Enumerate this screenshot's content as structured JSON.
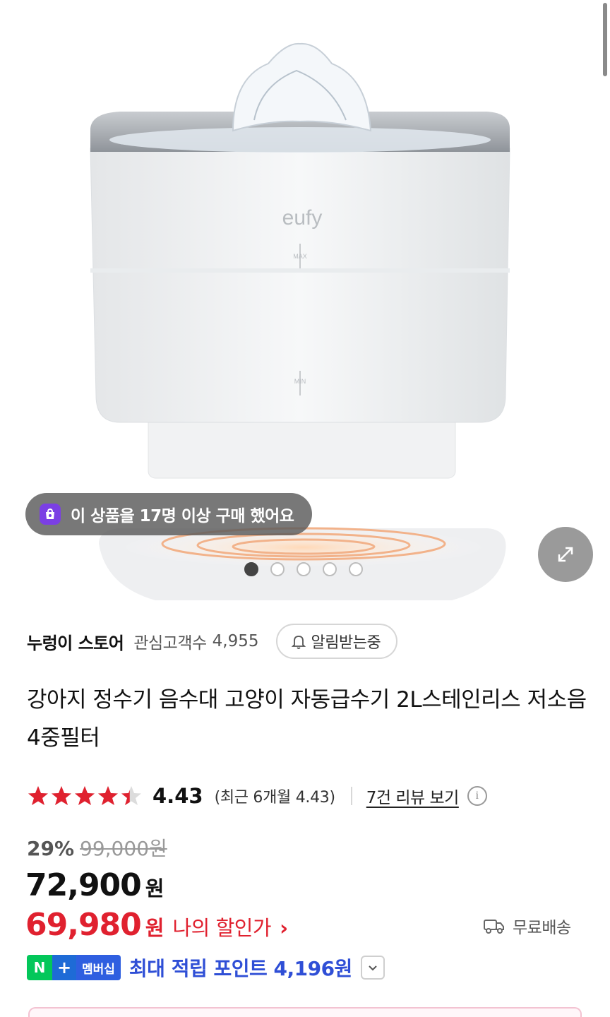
{
  "hero": {
    "brand_mark": "eufy",
    "scale_marks": [
      "MAX",
      "MIN"
    ],
    "purchase_badge": "이 상품을 17명 이상 구매 했어요",
    "carousel": {
      "total": 5,
      "active_index": 0
    }
  },
  "store": {
    "name": "누렁이 스토어",
    "fans_label": "관심고객수",
    "fans_count": "4,955",
    "alarm_label": "알림받는중"
  },
  "product": {
    "title": "강아지 정수기 음수대 고양이 자동급수기 2L스테인리스 저소음4중필터"
  },
  "rating": {
    "stars": 4.43,
    "value": "4.43",
    "recent": "(최근 6개월 4.43)",
    "reviews_link": "7건 리뷰 보기",
    "star_color": "#e0212f"
  },
  "price": {
    "discount_rate": "29%",
    "original": "99,000원",
    "sale": "72,900",
    "unit": "원",
    "my_price": "69,980",
    "my_price_label": "나의 할인가",
    "my_price_arrow": "›",
    "my_price_color": "#e0212f",
    "shipping": "무료배송"
  },
  "membership": {
    "n_label": "N",
    "plus_label": "+",
    "badge": "멤버십",
    "points_text": "최대 적립 포인트 4,196원",
    "points_color": "#2f4fd6"
  }
}
